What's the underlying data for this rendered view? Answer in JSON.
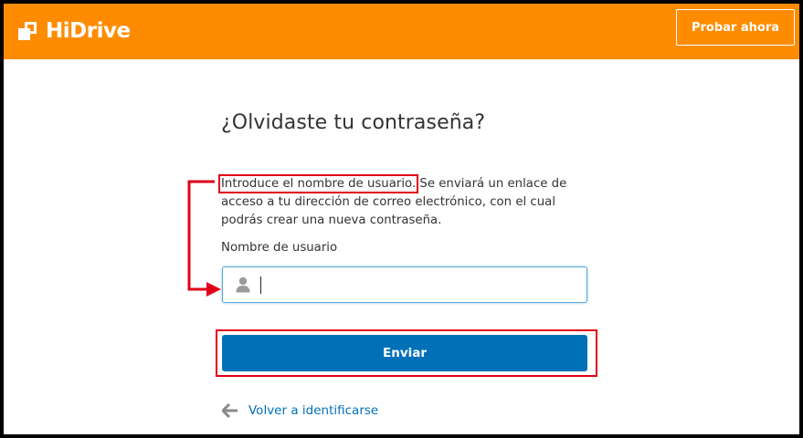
{
  "header": {
    "brand": "HiDrive",
    "try_button": "Probar ahora"
  },
  "form": {
    "title": "¿Olvidaste tu contraseña?",
    "description_highlight": "Introduce el nombre de usuario.",
    "description_rest": " Se enviará un enlace de acceso a tu dirección de correo electrónico, con el cual podrás crear una nueva contraseña.",
    "username_label": "Nombre de usuario",
    "username_value": "",
    "submit_label": "Enviar",
    "back_link": "Volver a identificarse"
  },
  "colors": {
    "header_bg": "#ff8c00",
    "primary": "#0071b9",
    "annotation": "#e1001a"
  },
  "icons": {
    "logo": "hidrive-logo-icon",
    "user": "user-icon",
    "back": "arrow-left-icon"
  }
}
